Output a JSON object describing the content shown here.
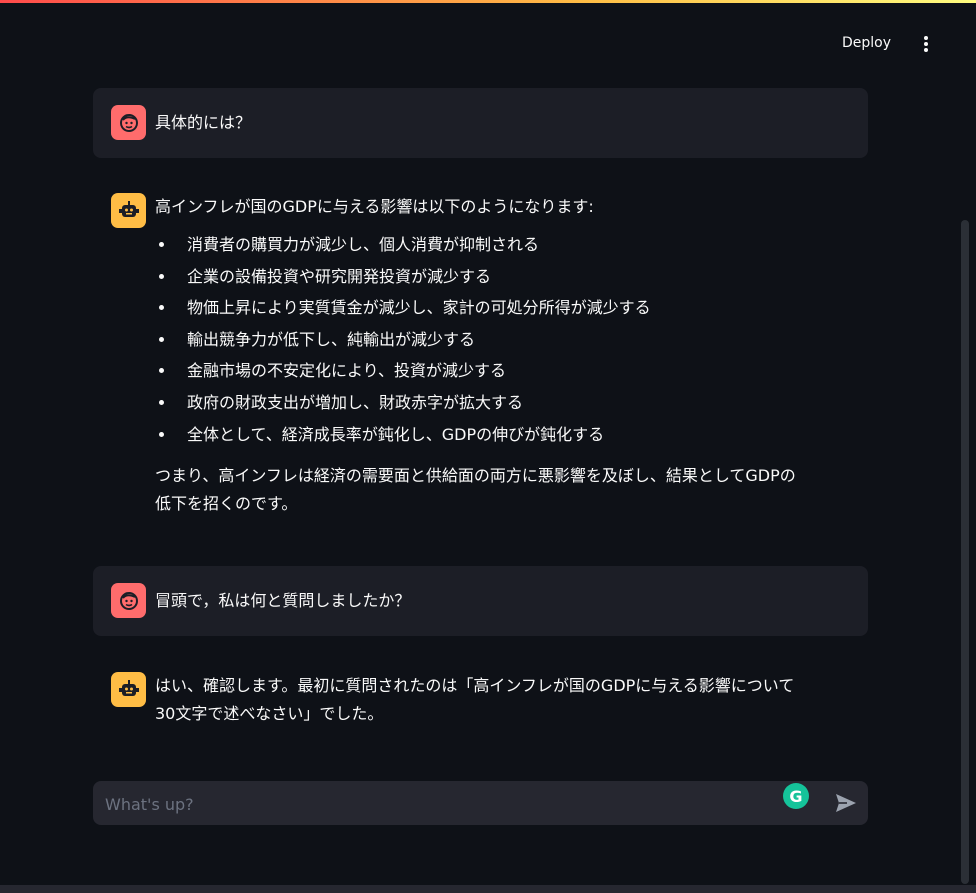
{
  "header": {
    "deploy_label": "Deploy",
    "menu_icon": "vertical-ellipsis-icon"
  },
  "messages": [
    {
      "role": "user",
      "avatar_icon": "smiley-face-icon",
      "text": "具体的には？"
    },
    {
      "role": "assistant",
      "avatar_icon": "robot-icon",
      "intro": "高インフレが国のGDPに与える影響は以下のようになります:",
      "bullets": [
        "消費者の購買力が減少し、個人消費が抑制される",
        "企業の設備投資や研究開発投資が減少する",
        "物価上昇により実質賃金が減少し、家計の可処分所得が減少する",
        "輸出競争力が低下し、純輸出が減少する",
        "金融市場の不安定化により、投資が減少する",
        "政府の財政支出が増加し、財政赤字が拡大する",
        "全体として、経済成長率が鈍化し、GDPの伸びが鈍化する"
      ],
      "summary_line1": "つまり、高インフレは経済の需要面と供給面の両方に悪影響を及ぼし、結果としてGDPの",
      "summary_line2": "低下を招くのです。"
    },
    {
      "role": "user",
      "avatar_icon": "smiley-face-icon",
      "text": "冒頭で，私は何と質問しましたか？"
    },
    {
      "role": "assistant",
      "avatar_icon": "robot-icon",
      "text_line1": "はい、確認します。最初に質問されたのは「高インフレが国のGDPに与える影響について",
      "text_line2": "30文字で述べなさい」でした。"
    }
  ],
  "chat_input": {
    "placeholder": "What's up?",
    "value": "",
    "grammarly_icon": "grammarly-icon",
    "grammarly_letter": "G",
    "send_icon": "send-arrow-icon"
  },
  "colors": {
    "background": "#0e1117",
    "user_bubble": "#1c1e26",
    "user_avatar": "#ff6c6c",
    "assistant_avatar": "#ffbd45",
    "input_bg": "#262730",
    "grammarly": "#15c39a"
  }
}
